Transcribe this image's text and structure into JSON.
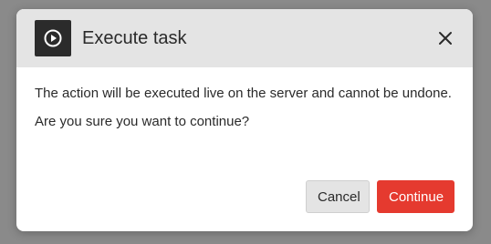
{
  "dialog": {
    "title": "Execute task",
    "header_icon": "play-circle-icon",
    "close_icon": "close-icon",
    "message_primary": "The action will be executed live on the server and cannot be undone.",
    "message_secondary": "Are you sure you want to continue?",
    "cancel_label": "Cancel",
    "continue_label": "Continue"
  },
  "colors": {
    "header_background": "#e4e4e4",
    "icon_box": "#2b2b2b",
    "primary_button": "#e53a2f",
    "backdrop": "#8a8a8a"
  }
}
